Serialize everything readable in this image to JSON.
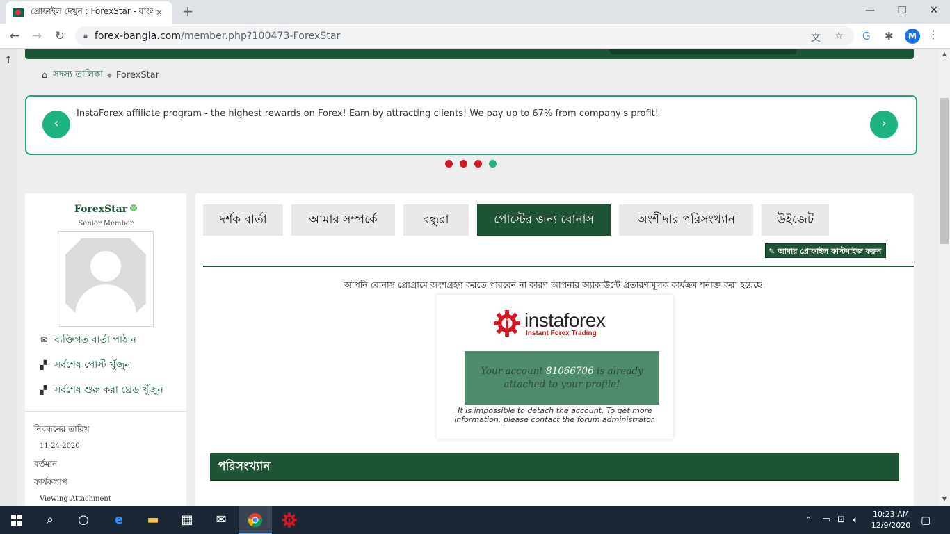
{
  "browser": {
    "tab_title": "প্রোফাইল দেখুন : ForexStar - বাংলা",
    "url_domain": "forex-bangla.com",
    "url_path": "/member.php?100473-ForexStar",
    "avatar_letter": "M"
  },
  "breadcrumb": {
    "members": "সদস্য তালিকা",
    "current": "ForexStar"
  },
  "banner": {
    "text": "InstaForex affiliate program - the highest rewards on Forex! Earn by attracting clients! We pay up to 67% from company's profit!",
    "active_dot": 3
  },
  "profile": {
    "name": "ForexStar",
    "rank": "Senior Member",
    "links": [
      "ব্যক্তিগত বার্তা পাঠান",
      "সর্বশেষ পোস্ট খুঁজুন",
      "সর্বশেষ শুরু করা থ্রেড খুঁজুন"
    ],
    "registration_label": "নিবন্ধনের তারিখ",
    "registration_date": "11-24-2020",
    "current_label": "বর্তমান",
    "activity_label": "কার্যকলাপ",
    "activity_value": "Viewing Attachment"
  },
  "tabs": [
    "দর্শক বার্তা",
    "আমার সম্পর্কে",
    "বন্ধুরা",
    "পোস্টের জন্য বোনাস",
    "অংশীদার পরিসংখ্যান",
    "উইজেট"
  ],
  "customize_label": "আমার প্রোফাইল কাস্টমাইজ করুন",
  "notice": "আপনি বোনাস প্রোগ্রামে অংশগ্রহণ করতে পারবেন না কারণ আপনার অ্যাকাউন্টে প্রতারণামূলক কার্যক্রম শনাক্ত করা হয়েছে।",
  "card": {
    "logo_name": "instaforex",
    "logo_tagline": "Instant Forex Trading",
    "account_pre": "Your account ",
    "account_number": "81066706",
    "account_post": " is already attached to your profile!",
    "note": "It is impossible to detach the account. To get more information, please contact the forum administrator."
  },
  "stats_title": "পরিসংখ্যান",
  "taskbar": {
    "time": "10:23 AM",
    "date": "12/9/2020"
  },
  "colors": {
    "brand_green": "#1f5537",
    "accent_teal": "#1db381",
    "dot_red": "#d01722",
    "account_box": "#4e8c6e"
  }
}
